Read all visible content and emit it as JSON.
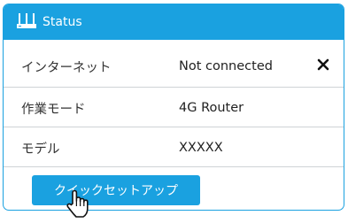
{
  "panel": {
    "title": "Status",
    "icons": {
      "router": "router-icon",
      "close": "close-icon",
      "cursor": "hand-pointer-icon"
    },
    "rows": [
      {
        "label": "インターネット",
        "value": "Not connected"
      },
      {
        "label": "作業モード",
        "value": "4G Router"
      },
      {
        "label": "モデル",
        "value": "XXXXX"
      }
    ],
    "button_label": "クイックセットアップ"
  },
  "colors": {
    "accent": "#1aa1e0",
    "divider": "#cfd3d6",
    "text": "#222222"
  }
}
